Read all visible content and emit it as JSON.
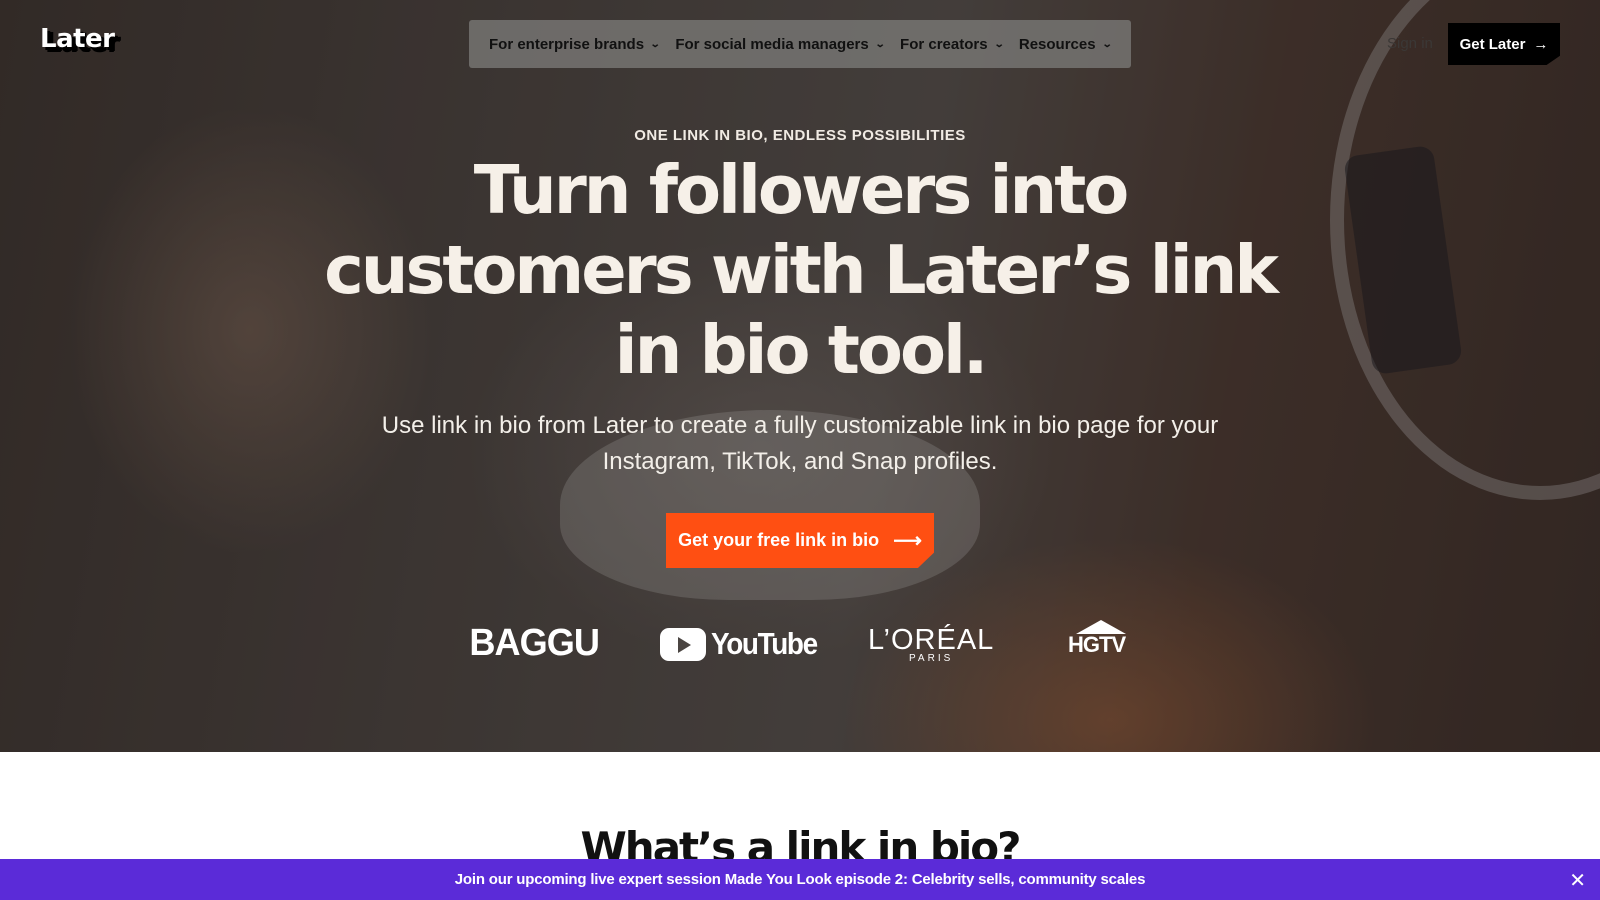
{
  "header": {
    "logo": "Later",
    "nav": [
      {
        "label": "For enterprise brands"
      },
      {
        "label": "For social media managers"
      },
      {
        "label": "For creators"
      },
      {
        "label": "Resources"
      }
    ],
    "sign_in": "Sign in",
    "get_later": "Get Later"
  },
  "hero": {
    "eyebrow": "ONE LINK IN BIO, ENDLESS POSSIBILITIES",
    "headline": "Turn followers into customers with Later’s link in bio tool.",
    "subhead": "Use link in bio from Later to create a fully customizable link in bio page for your Instagram, TikTok, and Snap profiles.",
    "cta": "Get your free link in bio",
    "brands": {
      "baggu": "BAGGU",
      "youtube": "YouTube",
      "loreal_main": "L’ORÉAL",
      "loreal_sub": "PARIS",
      "hgtv": "HGTV"
    }
  },
  "section": {
    "title": "What’s a link in bio?"
  },
  "banner": {
    "text": "Join our upcoming live expert session Made You Look episode 2: Celebrity sells, community scales",
    "close_icon": "close-icon"
  },
  "colors": {
    "cta": "#ff4f12",
    "banner": "#5b2bd8",
    "button_dark": "#000000"
  }
}
